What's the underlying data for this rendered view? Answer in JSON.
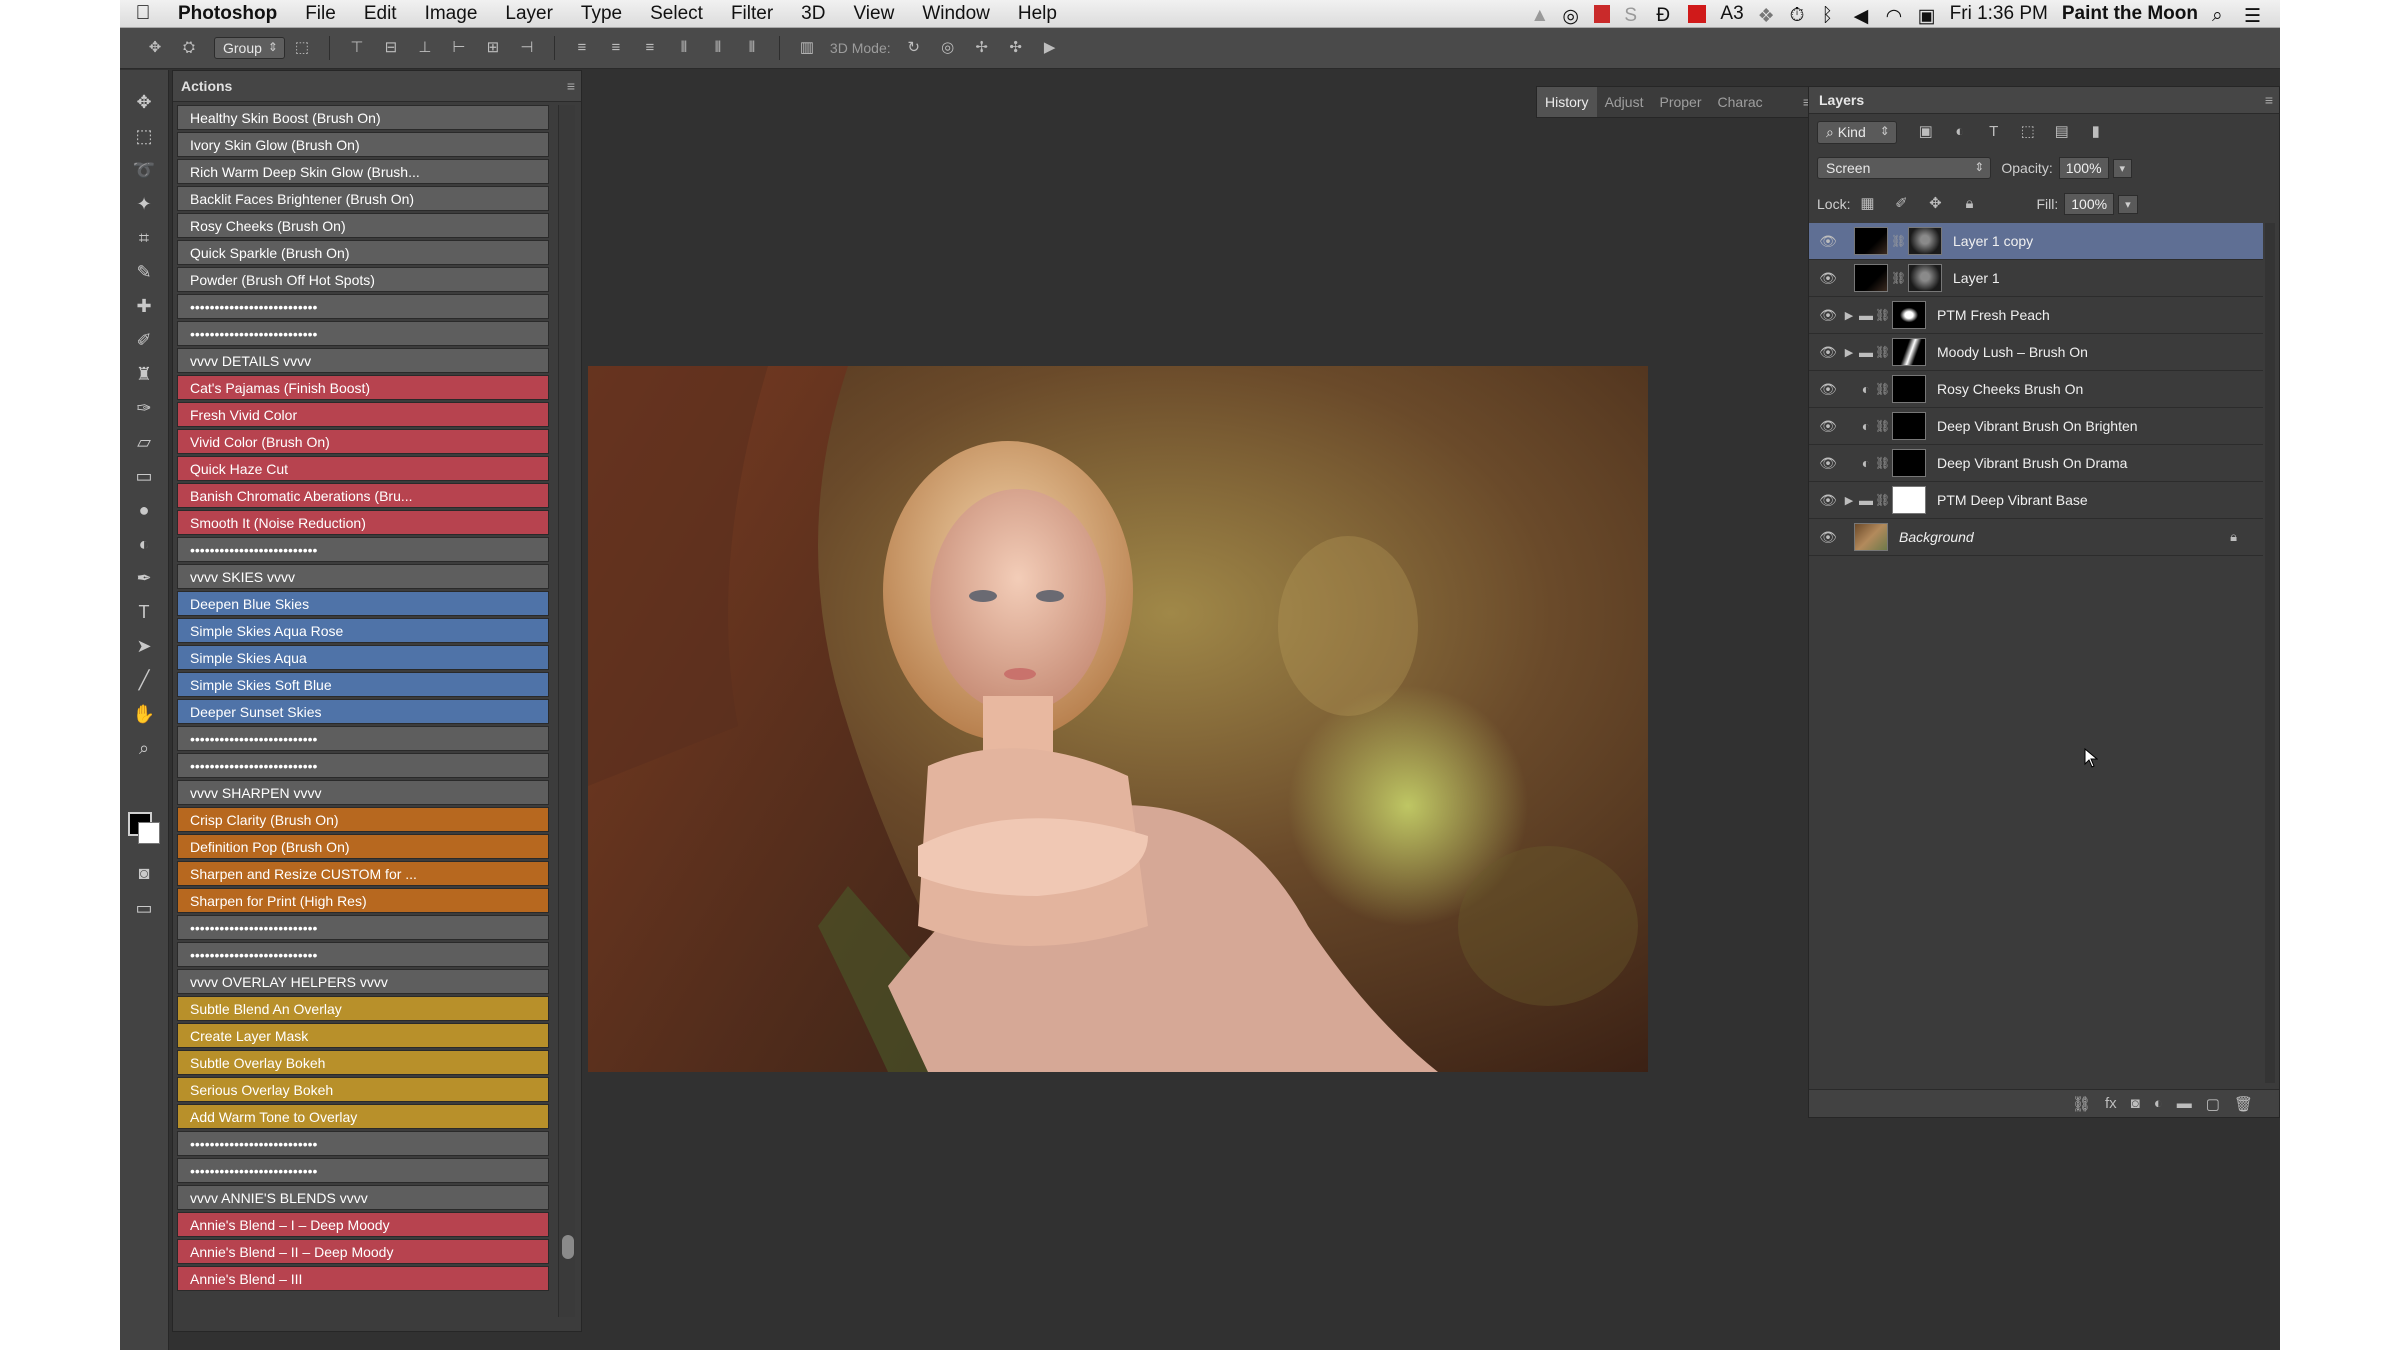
{
  "menubar": {
    "app": "Photoshop",
    "items": [
      "File",
      "Edit",
      "Image",
      "Layer",
      "Type",
      "Select",
      "Filter",
      "3D",
      "View",
      "Window",
      "Help"
    ],
    "badge": "3",
    "clock": "Fri 1:36 PM",
    "user": "Paint the Moon"
  },
  "options": {
    "group_select": "Group",
    "mode_label": "3D Mode:"
  },
  "actions_panel": {
    "title": "Actions",
    "items": [
      {
        "label": "Healthy Skin Boost (Brush On)",
        "color": "gray"
      },
      {
        "label": "Ivory Skin Glow (Brush On)",
        "color": "gray"
      },
      {
        "label": "Rich Warm Deep Skin Glow (Brush...",
        "color": "gray"
      },
      {
        "label": "Backlit Faces Brightener (Brush On)",
        "color": "gray"
      },
      {
        "label": "Rosy Cheeks (Brush On)",
        "color": "gray"
      },
      {
        "label": "Quick Sparkle (Brush On)",
        "color": "gray"
      },
      {
        "label": "Powder (Brush Off Hot Spots)",
        "color": "gray"
      },
      {
        "label": "••••••••••••••••••••••••••",
        "color": "gray"
      },
      {
        "label": "••••••••••••••••••••••••••",
        "color": "gray"
      },
      {
        "label": "vvvv  DETAILS vvvv",
        "color": "gray"
      },
      {
        "label": "Cat's Pajamas (Finish Boost)",
        "color": "red"
      },
      {
        "label": "Fresh Vivid Color",
        "color": "red"
      },
      {
        "label": "Vivid Color (Brush On)",
        "color": "red"
      },
      {
        "label": "Quick Haze Cut",
        "color": "red"
      },
      {
        "label": "Banish Chromatic Aberations (Bru...",
        "color": "red"
      },
      {
        "label": "Smooth It (Noise Reduction)",
        "color": "red"
      },
      {
        "label": "••••••••••••••••••••••••••",
        "color": "gray"
      },
      {
        "label": "vvvv  SKIES  vvvv",
        "color": "gray"
      },
      {
        "label": "Deepen Blue Skies",
        "color": "blue"
      },
      {
        "label": "Simple Skies Aqua Rose",
        "color": "blue"
      },
      {
        "label": "Simple Skies Aqua",
        "color": "blue"
      },
      {
        "label": "Simple Skies Soft Blue",
        "color": "blue"
      },
      {
        "label": "Deeper Sunset Skies",
        "color": "blue"
      },
      {
        "label": "••••••••••••••••••••••••••",
        "color": "gray"
      },
      {
        "label": "••••••••••••••••••••••••••",
        "color": "gray"
      },
      {
        "label": "vvvv  SHARPEN vvvv",
        "color": "gray"
      },
      {
        "label": "Crisp Clarity (Brush On)",
        "color": "orange"
      },
      {
        "label": "Definition Pop (Brush On)",
        "color": "orange"
      },
      {
        "label": "Sharpen and Resize CUSTOM for ...",
        "color": "orange"
      },
      {
        "label": "Sharpen for Print (High Res)",
        "color": "orange"
      },
      {
        "label": "••••••••••••••••••••••••••",
        "color": "gray"
      },
      {
        "label": "••••••••••••••••••••••••••",
        "color": "gray"
      },
      {
        "label": "vvvv  OVERLAY HELPERS vvvv",
        "color": "gray"
      },
      {
        "label": "Subtle Blend An Overlay",
        "color": "yellow"
      },
      {
        "label": "Create Layer Mask",
        "color": "yellow"
      },
      {
        "label": "Subtle Overlay Bokeh",
        "color": "yellow"
      },
      {
        "label": "Serious Overlay Bokeh",
        "color": "yellow"
      },
      {
        "label": "Add Warm Tone to Overlay",
        "color": "yellow"
      },
      {
        "label": "••••••••••••••••••••••••••",
        "color": "gray"
      },
      {
        "label": "••••••••••••••••••••••••••",
        "color": "gray"
      },
      {
        "label": "vvvv  ANNIE'S BLENDS vvvv",
        "color": "gray"
      },
      {
        "label": "Annie's Blend – I – Deep Moody",
        "color": "red"
      },
      {
        "label": "Annie's Blend – II – Deep Moody",
        "color": "red"
      },
      {
        "label": "Annie's Blend – III",
        "color": "red"
      }
    ]
  },
  "mini_panel": {
    "tabs": [
      "History",
      "Adjust",
      "Proper",
      "Charac"
    ]
  },
  "layers_panel": {
    "title": "Layers",
    "kind": "Kind",
    "blend_mode": "Screen",
    "opacity_label": "Opacity:",
    "opacity": "100%",
    "lock_label": "Lock:",
    "fill_label": "Fill:",
    "fill": "100%",
    "layers": [
      {
        "name": "Layer 1 copy",
        "selected": true,
        "kind": "pixel",
        "thumb": "dark",
        "mask": "mask"
      },
      {
        "name": "Layer 1",
        "selected": false,
        "kind": "pixel",
        "thumb": "dark",
        "mask": "mask"
      },
      {
        "name": "PTM Fresh Peach",
        "selected": false,
        "kind": "group",
        "thumb": "",
        "mask": "mask2"
      },
      {
        "name": "Moody Lush – Brush On",
        "selected": false,
        "kind": "group",
        "thumb": "",
        "mask": "mask3"
      },
      {
        "name": "Rosy Cheeks Brush On",
        "selected": false,
        "kind": "adjust",
        "thumb": "",
        "mask": "black"
      },
      {
        "name": "Deep Vibrant Brush On Brighten",
        "selected": false,
        "kind": "adjust",
        "thumb": "",
        "mask": "black"
      },
      {
        "name": "Deep Vibrant Brush On Drama",
        "selected": false,
        "kind": "adjust",
        "thumb": "",
        "mask": "black"
      },
      {
        "name": "PTM Deep Vibrant Base",
        "selected": false,
        "kind": "group",
        "thumb": "",
        "mask": "white"
      },
      {
        "name": "Background",
        "selected": false,
        "kind": "background",
        "thumb": "photo",
        "mask": ""
      }
    ]
  }
}
